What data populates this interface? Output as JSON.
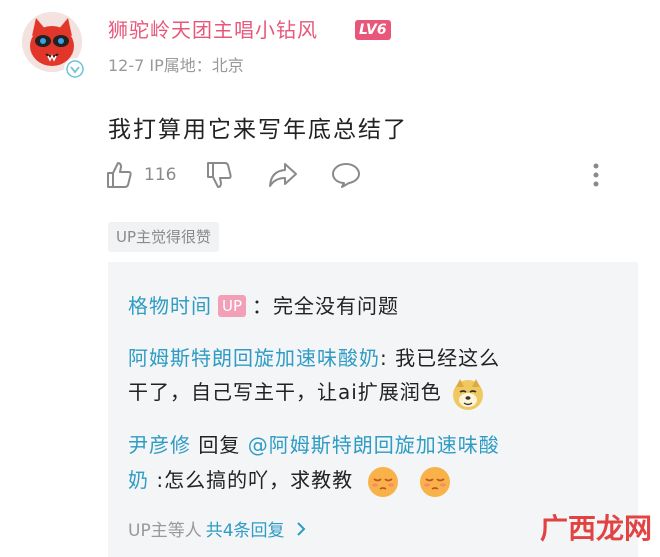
{
  "comment": {
    "username": "狮驼岭天团主唱小钻风",
    "level": "LV6",
    "meta": "12-7  IP属地：北京",
    "text": "我打算用它来写年底总结了",
    "likes": "116",
    "up_liked_tag": "UP主觉得很赞"
  },
  "replies": [
    {
      "user": "格物时间",
      "up_badge": "UP",
      "separator": "：",
      "text": "完全没有问题"
    },
    {
      "user": "阿姆斯特朗回旋加速味酸奶",
      "separator": ":",
      "line1": " 我已经这么",
      "line2": "干了，自己写主干，让ai扩展润色"
    },
    {
      "user": "尹彦修",
      "reply_word": " 回复 ",
      "mention_line1": "@阿姆斯特朗回旋加速味酸",
      "mention_line2": "奶",
      "line2": " :怎么搞的吖，求教教"
    }
  ],
  "more_replies": {
    "prefix": "UP主等人",
    "link": "共4条回复"
  },
  "watermark": "广西龙网",
  "colors": {
    "username_pink": "#e8577a",
    "link_blue": "#2e9cc4",
    "reply_bg": "#f4f5f7"
  },
  "icons": [
    "avatar-red-cat",
    "verify-badge-icon",
    "like-icon",
    "dislike-icon",
    "share-icon",
    "comment-icon",
    "more-vertical-icon",
    "doge-emoji",
    "sleepy-emoji",
    "chevron-right-icon"
  ]
}
